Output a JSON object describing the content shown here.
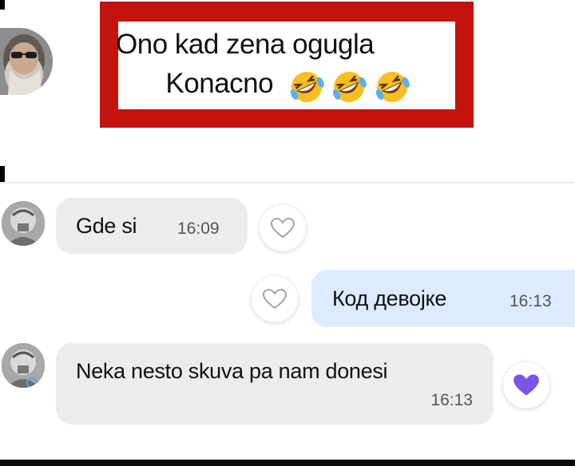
{
  "post": {
    "caption_line1": "Ono kad zena ogugla",
    "caption_line2": "Konacno",
    "caption_emoji": "rolling-on-floor-laughing-icon",
    "frame_color": "#c4120c"
  },
  "messages": [
    {
      "direction": "incoming",
      "text": "Gde si",
      "time": "16:09",
      "reaction": "heart-outline-icon"
    },
    {
      "direction": "outgoing",
      "text": "Код девојке",
      "time": "16:13",
      "reaction": "heart-outline-icon"
    },
    {
      "direction": "incoming",
      "text": "Neka nesto skuva pa nam donesi",
      "time": "16:13",
      "reaction": "heart-filled-icon"
    }
  ],
  "colors": {
    "incoming_bubble": "#ececef",
    "outgoing_bubble": "#dcebff",
    "heart_active": "#7a55e6"
  }
}
